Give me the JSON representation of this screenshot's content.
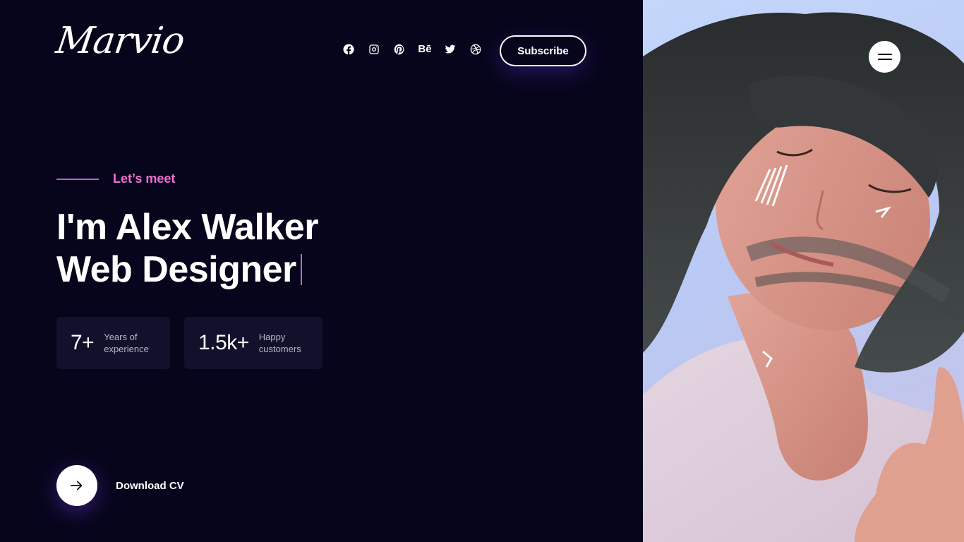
{
  "brand": {
    "logo_text": "Marvio"
  },
  "header": {
    "social_icons": [
      "facebook-icon",
      "instagram-icon",
      "pinterest-icon",
      "behance-icon",
      "twitter-icon",
      "dribbble-icon"
    ],
    "behance_text": "Bē",
    "subscribe_label": "Subscribe"
  },
  "hero": {
    "eyebrow": "Let’s meet",
    "headline_line1": "I'm Alex Walker",
    "headline_line2": "Web Designer",
    "stats": [
      {
        "number": "7+",
        "label_line1": "Years of",
        "label_line2": "experience"
      },
      {
        "number": "1.5k+",
        "label_line1": "Happy",
        "label_line2": "customers"
      }
    ],
    "download_label": "Download CV"
  },
  "colors": {
    "background": "#07051c",
    "accent_pink": "#f16fd2",
    "accent_line": "#b560d4",
    "stat_card": "#12102a",
    "photo_bg": "#c5d6fb"
  },
  "photo": {
    "subject": "portrait-photo"
  }
}
